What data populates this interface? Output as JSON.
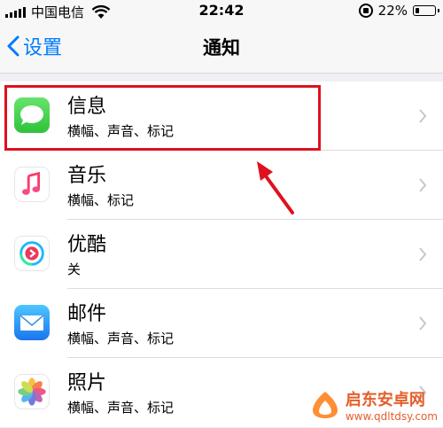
{
  "status_bar": {
    "carrier": "中国电信",
    "time": "22:42",
    "battery_percent": "22%",
    "battery_level": 0.22
  },
  "nav": {
    "back_label": "设置",
    "title": "通知"
  },
  "apps": [
    {
      "name": "信息",
      "subtitle": "横幅、声音、标记",
      "icon": "messages-icon"
    },
    {
      "name": "音乐",
      "subtitle": "横幅、标记",
      "icon": "music-icon"
    },
    {
      "name": "优酷",
      "subtitle": "关",
      "icon": "youku-icon"
    },
    {
      "name": "邮件",
      "subtitle": "横幅、声音、标记",
      "icon": "mail-icon"
    },
    {
      "name": "照片",
      "subtitle": "横幅、声音、标记",
      "icon": "photos-icon"
    }
  ],
  "watermark": {
    "title": "启东安卓网",
    "url": "www.qdltdsy.com"
  },
  "colors": {
    "accent": "#007aff",
    "highlight": "#e0101e",
    "background": "#efeff4"
  }
}
